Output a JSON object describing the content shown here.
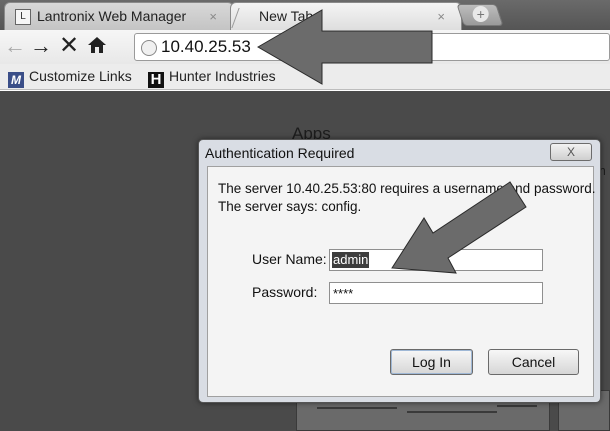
{
  "browser": {
    "tabs": [
      {
        "label": "Lantronix Web Manager",
        "close": "×"
      },
      {
        "label": "New Tab",
        "close": "×"
      }
    ],
    "new_tab": "+",
    "nav": {
      "back": "←",
      "forward": "→",
      "stop": "✕",
      "home": "⌂"
    },
    "address": "10.40.25.53"
  },
  "bookmarks": [
    {
      "icon_letter": "M",
      "label": "Customize Links"
    },
    {
      "icon_letter": "H",
      "label": "Hunter Industries"
    }
  ],
  "page": {
    "apps_title": "Apps",
    "apps_cut_text": "m"
  },
  "dialog": {
    "title": "Authentication Required",
    "close": "X",
    "message_line1": "The server 10.40.25.53:80 requires a username and password.",
    "message_line2": "The server says: config.",
    "username_label": "User Name:",
    "username_value": "admin",
    "password_label": "Password:",
    "password_value": "****",
    "login_button": "Log In",
    "cancel_button": "Cancel"
  },
  "colors": {
    "annotation_arrow": "#6b6b6b",
    "page_overlay": "#4a4a4a",
    "dialog_frame": "#d9dde4"
  }
}
